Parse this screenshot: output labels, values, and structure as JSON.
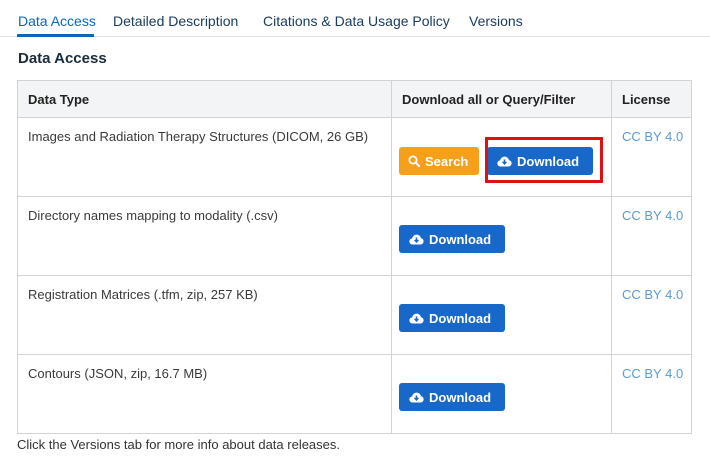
{
  "tabs": [
    {
      "label": "Data Access",
      "active": true
    },
    {
      "label": "Detailed Description",
      "active": false
    },
    {
      "label": "Citations & Data Usage Policy",
      "active": false
    },
    {
      "label": "Versions",
      "active": false
    }
  ],
  "section_title": "Data Access",
  "table": {
    "headers": [
      "Data Type",
      "Download all or Query/Filter",
      "License"
    ],
    "rows": [
      {
        "data_type": "Images and Radiation Therapy Structures (DICOM, 26 GB)",
        "search_label": "Search",
        "download_label": "Download",
        "license": "CC BY 4.0"
      },
      {
        "data_type": "Directory names mapping to modality (.csv)",
        "download_label": "Download",
        "license": "CC BY 4.0"
      },
      {
        "data_type": "Registration Matrices (.tfm, zip, 257 KB)",
        "download_label": "Download",
        "license": "CC BY 4.0"
      },
      {
        "data_type": "Contours (JSON, zip, 16.7 MB)",
        "download_label": "Download",
        "license": "CC BY 4.0"
      }
    ]
  },
  "footer_note": "Click the Versions tab for more info about data releases.",
  "colors": {
    "accent": "#0b66c3",
    "search_button": "#f6a01a",
    "download_button": "#1768c8",
    "license_link": "#5b9bd5",
    "highlight": "#e01010"
  },
  "icons": {
    "search": "magnifier-icon",
    "download": "cloud-download-icon"
  }
}
